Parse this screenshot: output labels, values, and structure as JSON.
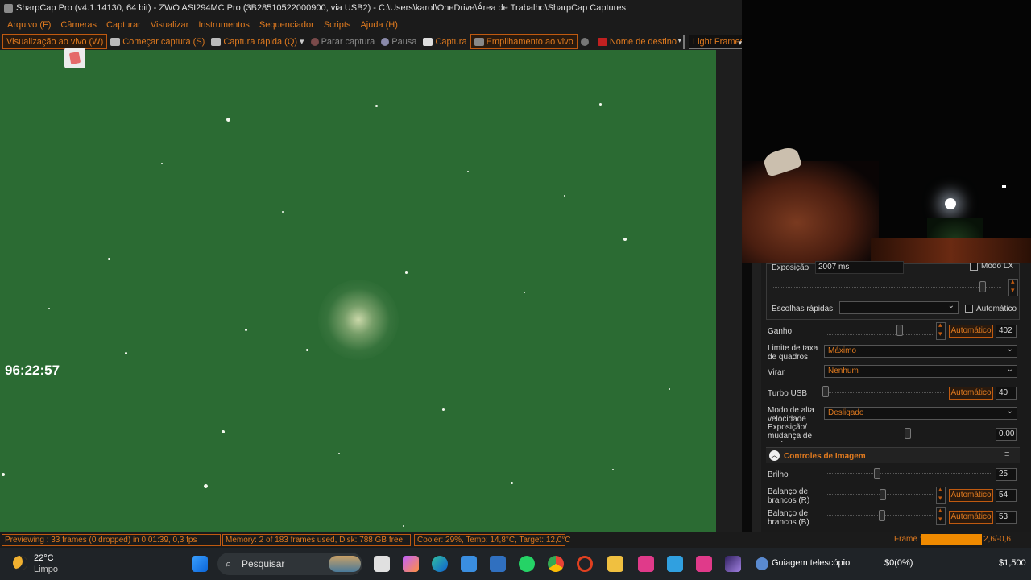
{
  "window": {
    "title": "SharpCap Pro (v4.1.14130, 64 bit) - ZWO ASI294MC Pro (3B28510522000900, via USB2) - C:\\Users\\karol\\OneDrive\\Área de Trabalho\\SharpCap Captures"
  },
  "menu": [
    "Arquivo (F)",
    "Câmeras",
    "Capturar",
    "Visualizar",
    "Instrumentos",
    "Sequenciador",
    "Scripts",
    "Ajuda (H)"
  ],
  "toolbar": {
    "live_view": "Visualização ao vivo (W)",
    "start_capture": "Começar captura (S)",
    "quick_capture": "Captura rápida (Q)",
    "stop_capture": "Parar captura",
    "pause": "Pausa",
    "snapshot": "Captura",
    "live_stack": "Empilhamento ao vivo",
    "target_name": "Nome de destino",
    "target_value": "",
    "frame_type": "Light Frames"
  },
  "overlay": {
    "timer": "96:22:57"
  },
  "controls": {
    "exposure_label": "Exposição",
    "exposure_value": "2007 ms",
    "lx_mode_label": "Modo LX",
    "quick_picks_label": "Escolhas rápidas",
    "quick_picks_value": "",
    "auto_label": "Automático",
    "gain_label": "Ganho",
    "gain_value": "402",
    "frame_rate_label": "Limite de taxa de quadros",
    "frame_rate_value": "Máximo",
    "flip_label": "Virar",
    "flip_value": "Nenhum",
    "turbo_label": "Turbo USB",
    "turbo_value": "40",
    "hispeed_label": "Modo de alta velocidade",
    "hispeed_value": "Desligado",
    "exp_gain_label": "Exposição/ mudança de ganho",
    "exp_gain_value": "0.00",
    "image_controls_title": "Controles de Imagem",
    "brightness_label": "Brilho",
    "brightness_value": "25",
    "wb_r_label": "Balanço de brancos (R)",
    "wb_r_value": "54",
    "wb_b_label": "Balanço de brancos (B)",
    "wb_b_value": "53",
    "automatic_btn": "Automático"
  },
  "status": {
    "previewing": "Previewing : 33 frames (0 dropped) in 0:01:39, 0,3 fps",
    "memory": "Memory: 2 of 183 frames used, Disk: 788 GB free",
    "cooler": "Cooler: 29%, Temp: 14,8°C, Target: 12,0°C",
    "frame_label": "Frame :",
    "frame_value": "2,6/-0,6"
  },
  "taskbar": {
    "weather_temp": "22°C",
    "weather_desc": "Limpo",
    "search_placeholder": "Pesquisar",
    "stellarium_label": "Guiagem telescópio",
    "price1": "$0(0%)",
    "price2": "$1,500"
  }
}
